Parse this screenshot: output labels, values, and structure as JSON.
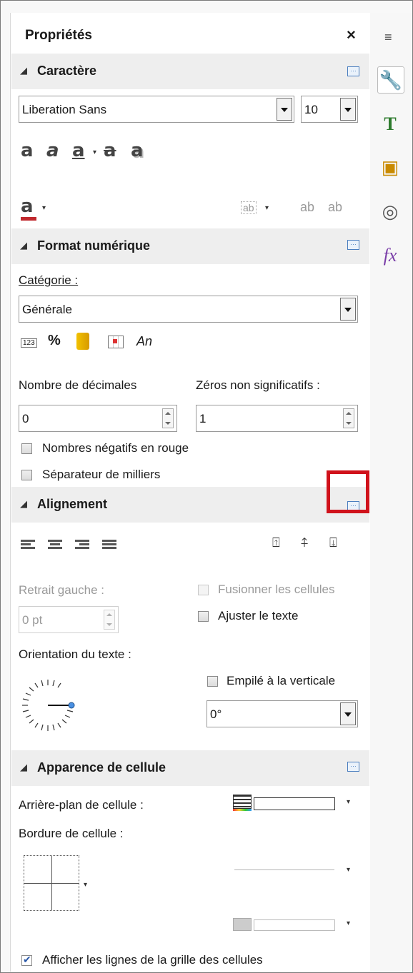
{
  "panel": {
    "title": "Propriétés",
    "close_glyph": "×",
    "menu_glyph": "≡"
  },
  "caractere": {
    "header": "Caractère",
    "font_name": "Liberation Sans",
    "font_size": "10",
    "style_glyphs": [
      "a",
      "a",
      "a",
      "a",
      "a"
    ],
    "font_color_glyph": "a",
    "spacing_glyph": "ab",
    "superscript_glyph": "ab",
    "subscript_glyph": "ab"
  },
  "format": {
    "header": "Format numérique",
    "category_label": "Catégorie :",
    "category_value": "Générale",
    "num_icon": "123",
    "percent_icon": "%",
    "text_icon": "An",
    "decimals_label": "Nombre de décimales",
    "decimals_value": "0",
    "zeros_label": "Zéros non significatifs :",
    "zeros_value": "1",
    "negative_red_label": "Nombres négatifs en rouge",
    "thousands_sep_label": "Séparateur de milliers"
  },
  "alignement": {
    "header": "Alignement",
    "indent_label": "Retrait gauche :",
    "indent_value": "0 pt",
    "merge_label": "Fusionner les cellules",
    "wrap_label": "Ajuster le texte",
    "orientation_label": "Orientation du texte :",
    "stacked_label": "Empilé à la verticale",
    "angle_value": "0°"
  },
  "apparence": {
    "header": "Apparence de cellule",
    "background_label": "Arrière-plan de cellule :",
    "border_label": "Bordure de cellule :",
    "gridlines_label": "Afficher les lignes de la grille des cellules",
    "gridlines_checked": true
  },
  "sidebar_tabs": [
    "wrench-icon",
    "styles-icon",
    "gallery-icon",
    "navigator-icon",
    "functions-icon"
  ],
  "colors": {
    "highlight": "#d0121b",
    "accent": "#4a7ebf",
    "font_color_bar": "#c0282d"
  }
}
